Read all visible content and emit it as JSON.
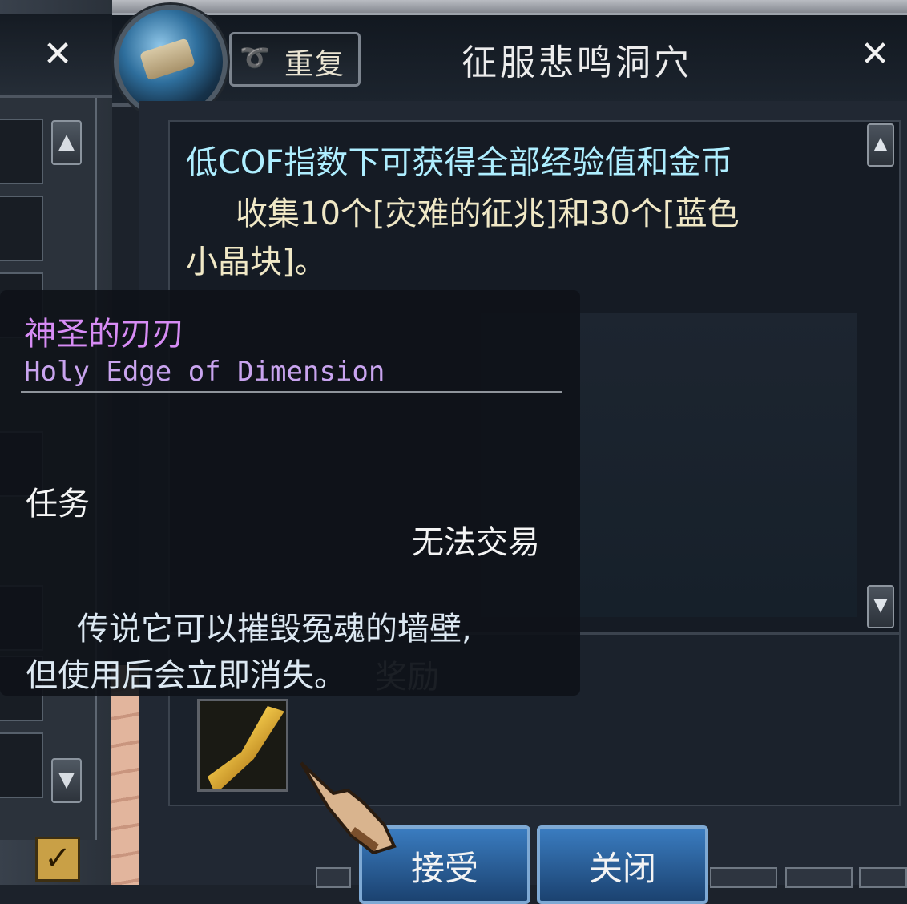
{
  "header": {
    "title": "征服悲鸣洞穴",
    "repeat_label": "重复",
    "close_glyph": "✕"
  },
  "quest": {
    "desc_line1": "低COF指数下可获得全部经验值和金币",
    "desc_line2": "收集10个[灾难的征兆]和30个[蓝色",
    "desc_line3": "小晶块]。",
    "reward_label": "奖励"
  },
  "buttons": {
    "accept": "接受",
    "close": "关闭"
  },
  "tooltip": {
    "name_cn": "神圣的刃刃",
    "name_en": "Holy Edge of Dimension",
    "type": "任务",
    "trade": "无法交易",
    "desc_line1": "传说它可以摧毁冤魂的墙壁,",
    "desc_line2": "但使用后会立即消失。"
  },
  "colors": {
    "item_name": "#d78cf5",
    "quest_highlight": "#aeeeff",
    "quest_text": "#f0e8c6",
    "button_blue": "#2a5fa0"
  },
  "icons": [
    "repeat-scroll-icon",
    "quest-emblem-icon",
    "close-icon",
    "scroll-up-icon",
    "scroll-down-icon",
    "reward-blade-icon",
    "cursor-hand-icon",
    "checkbox-icon"
  ]
}
